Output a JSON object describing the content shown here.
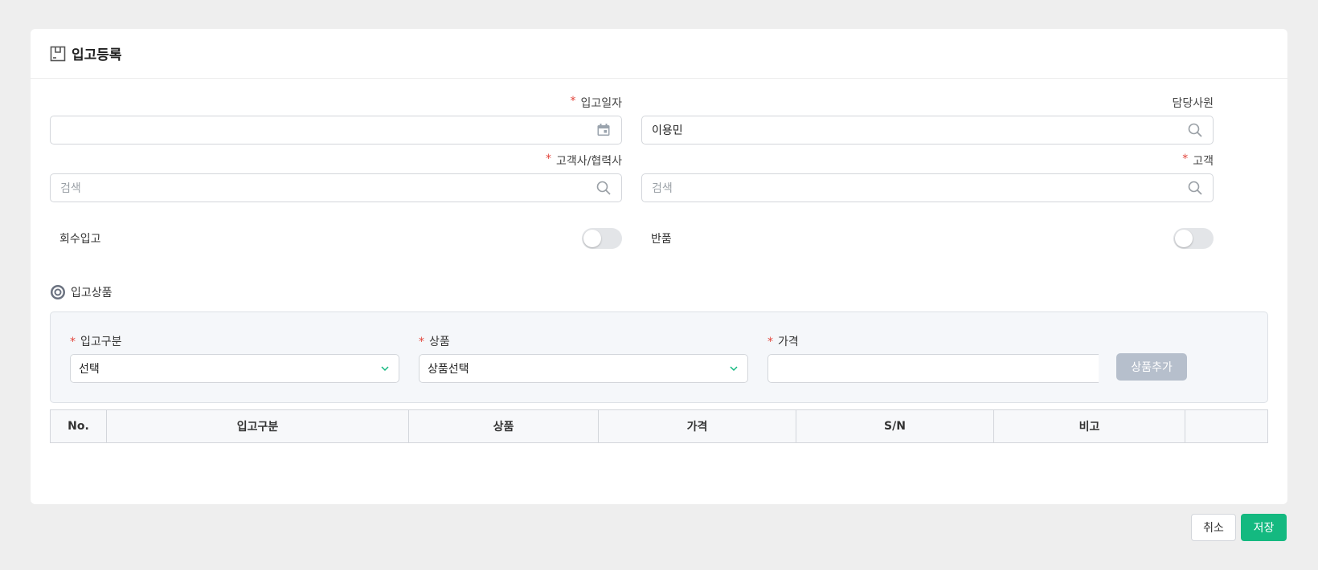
{
  "header": {
    "title": "입고등록",
    "icon": "box-icon"
  },
  "form": {
    "receipt_date": {
      "label": "입고일자",
      "value": "",
      "icon": "calendar-icon"
    },
    "staff": {
      "label": "담당사원",
      "value": "이용민",
      "icon": "search-icon"
    },
    "partner": {
      "label": "고객사/협력사",
      "placeholder": "검색",
      "icon": "search-icon"
    },
    "customer": {
      "label": "고객",
      "placeholder": "검색",
      "icon": "search-icon"
    },
    "recall_toggle": {
      "label": "회수입고",
      "on": false
    },
    "return_toggle": {
      "label": "반품",
      "on": false
    },
    "required_mark": "*"
  },
  "items_section": {
    "title": "입고상품",
    "type_field": {
      "label": "입고구분",
      "value": "선택"
    },
    "product_field": {
      "label": "상품",
      "value": "상품선택"
    },
    "price_field": {
      "label": "가격",
      "value": ""
    },
    "add_button": "상품추가"
  },
  "table": {
    "columns": [
      "No.",
      "입고구분",
      "상품",
      "가격",
      "S/N",
      "비고",
      ""
    ]
  },
  "footer": {
    "cancel": "취소",
    "save": "저장"
  },
  "colors": {
    "accent": "#14b980",
    "required": "#e2453c",
    "disabled_button": "#b6bfcc"
  }
}
